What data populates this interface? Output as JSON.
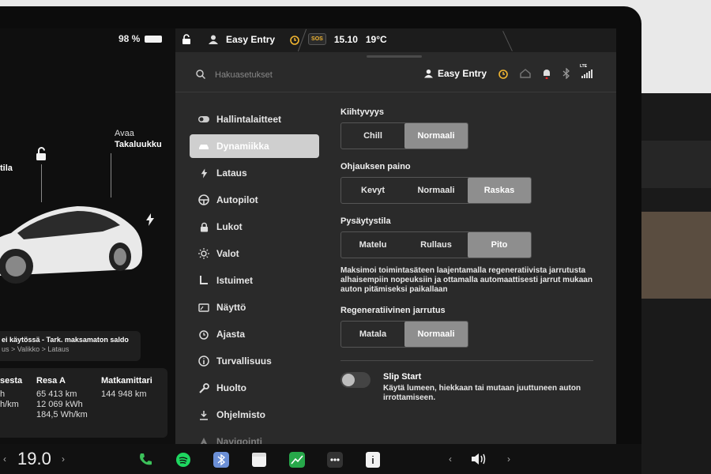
{
  "car_panel": {
    "battery_percent": "98 %",
    "label_trunk_line1": "Avaa",
    "label_trunk_line2": "Takaluukku",
    "label_frunk": "tila",
    "notice_title": "ei käytössä - Tark. maksamaton saldo",
    "notice_path": "us > Valikko > Lataus",
    "trip": {
      "col1_header": "sesta",
      "col1_values": [
        "",
        "h",
        "h/km"
      ],
      "col2_header": "Resa A",
      "col2_values": [
        "65 413 km",
        "12 069 kWh",
        "184,5 Wh/km"
      ],
      "col3_header": "Matkamittari",
      "col3_values": [
        "144 948 km"
      ]
    }
  },
  "topbar": {
    "profile": "Easy Entry",
    "sos": "SOS",
    "time": "15.10",
    "temperature": "19°C"
  },
  "settings": {
    "search_placeholder": "Hakuasetukset",
    "header_profile": "Easy Entry",
    "lte": "LTE",
    "nav_items": [
      {
        "label": "Hallintalaitteet",
        "icon": "toggle-icon"
      },
      {
        "label": "Dynamiikka",
        "icon": "car-icon"
      },
      {
        "label": "Lataus",
        "icon": "bolt-icon"
      },
      {
        "label": "Autopilot",
        "icon": "steering-wheel-icon"
      },
      {
        "label": "Lukot",
        "icon": "lock-icon"
      },
      {
        "label": "Valot",
        "icon": "sun-icon"
      },
      {
        "label": "Istuimet",
        "icon": "seat-icon"
      },
      {
        "label": "Näyttö",
        "icon": "display-icon"
      },
      {
        "label": "Ajasta",
        "icon": "alarm-icon"
      },
      {
        "label": "Turvallisuus",
        "icon": "info-icon"
      },
      {
        "label": "Huolto",
        "icon": "wrench-icon"
      },
      {
        "label": "Ohjelmisto",
        "icon": "download-icon"
      },
      {
        "label": "Navigointi",
        "icon": "navigation-icon"
      }
    ],
    "active_nav": "Dynamiikka",
    "acceleration": {
      "title": "Kiihtyvyys",
      "options": [
        "Chill",
        "Normaali"
      ],
      "selected": "Normaali"
    },
    "steering": {
      "title": "Ohjauksen paino",
      "options": [
        "Kevyt",
        "Normaali",
        "Raskas"
      ],
      "selected": "Raskas"
    },
    "stopping": {
      "title": "Pysäytystila",
      "options": [
        "Matelu",
        "Rullaus",
        "Pito"
      ],
      "selected": "Pito",
      "description": "Maksimoi toimintasäteen laajentamalla regeneratiivista jarrutusta alhaisempiin nopeuksiin ja ottamalla automaattisesti jarrut mukaan auton pitämiseksi paikallaan"
    },
    "regen": {
      "title": "Regeneratiivinen jarrutus",
      "options": [
        "Matala",
        "Normaali"
      ],
      "selected": "Normaali"
    },
    "slip_start": {
      "title": "Slip Start",
      "description": "Käytä lumeen, hiekkaan tai mutaan juuttuneen auton irrottamiseen.",
      "enabled": false
    }
  },
  "dock": {
    "speed": "19.0"
  },
  "colors": {
    "accent_yellow": "#f2b631",
    "panel_bg": "#2a2a2a",
    "selected_segment": "#8e8e8e",
    "active_nav": "#cfcfcf"
  }
}
